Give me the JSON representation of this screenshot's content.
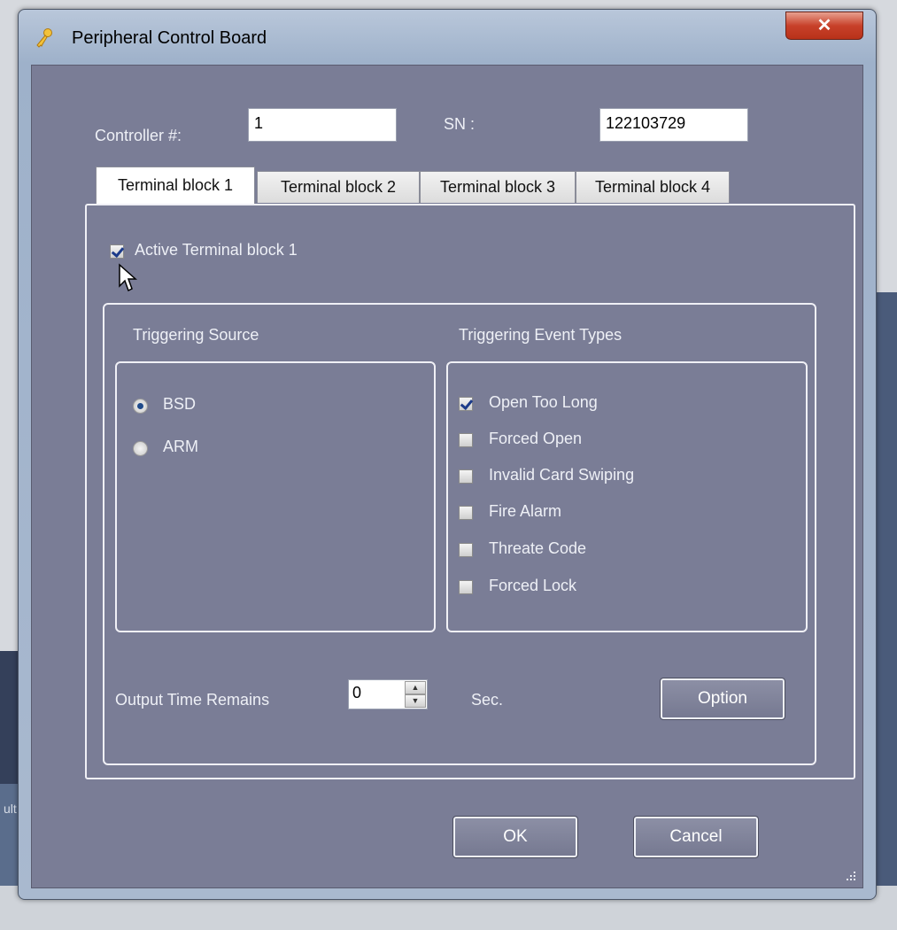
{
  "window": {
    "title": "Peripheral Control Board",
    "close_icon": "close-icon",
    "title_icon": "key-icon"
  },
  "header": {
    "controller_label": "Controller #:",
    "controller_value": "1",
    "sn_label": "SN :",
    "sn_value": "122103729"
  },
  "tabs": [
    {
      "label": "Terminal block 1",
      "active": true
    },
    {
      "label": "Terminal block 2",
      "active": false
    },
    {
      "label": "Terminal block 3",
      "active": false
    },
    {
      "label": "Terminal block 4",
      "active": false
    }
  ],
  "panel": {
    "active_checkbox_label": "Active Terminal block 1",
    "active_checked": true,
    "triggering_source": {
      "title": "Triggering Source",
      "options": [
        {
          "label": "BSD",
          "selected": true
        },
        {
          "label": "ARM",
          "selected": false
        }
      ]
    },
    "triggering_event_types": {
      "title": "Triggering Event Types",
      "options": [
        {
          "label": "Open Too Long",
          "checked": true
        },
        {
          "label": "Forced Open",
          "checked": false
        },
        {
          "label": "Invalid Card Swiping",
          "checked": false
        },
        {
          "label": "Fire Alarm",
          "checked": false
        },
        {
          "label": "Threate Code",
          "checked": false
        },
        {
          "label": "Forced Lock",
          "checked": false
        }
      ]
    },
    "output_time_label": "Output Time Remains",
    "output_time_value": "0",
    "unit_label": "Sec.",
    "option_button": "Option"
  },
  "footer": {
    "ok_button": "OK",
    "cancel_button": "Cancel"
  },
  "background": {
    "side_text": "ult"
  },
  "colors": {
    "client_bg": "#7a7d96",
    "title_gradient": "#a9b9cf",
    "close_red": "#c8412a"
  }
}
